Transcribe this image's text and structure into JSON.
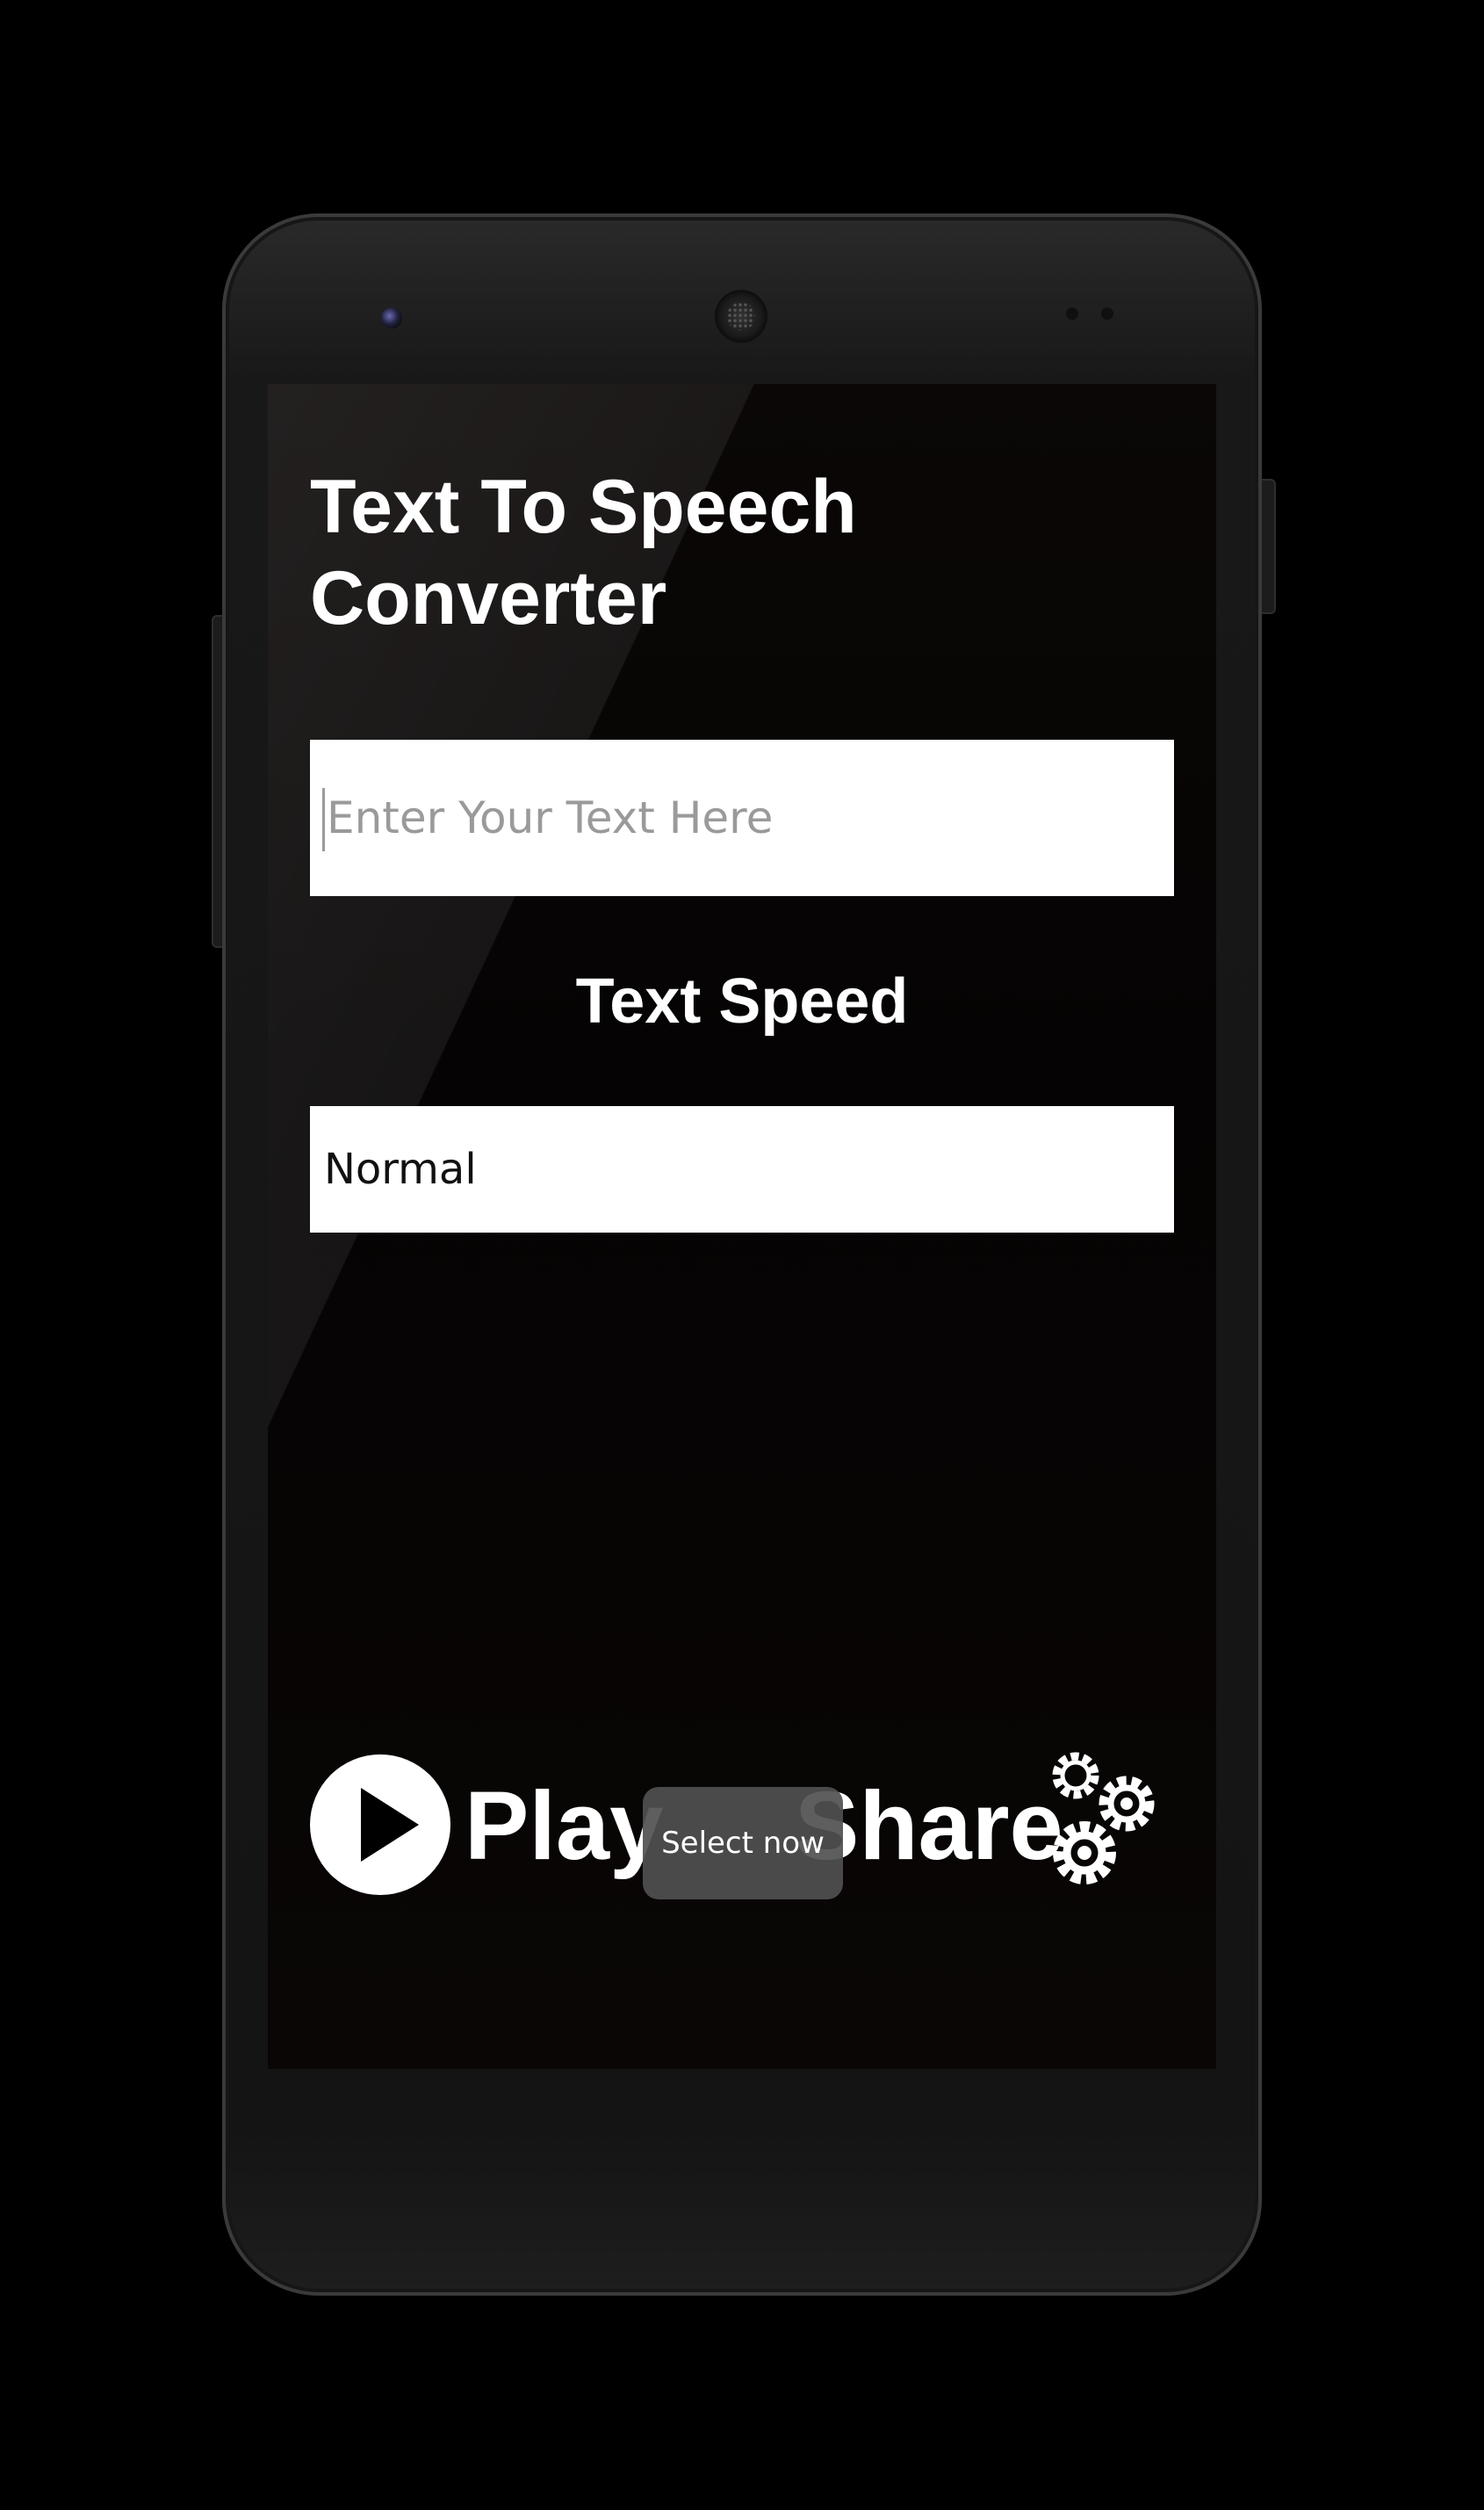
{
  "app": {
    "title": "Text To Speech Converter"
  },
  "text_input": {
    "value": "",
    "placeholder": "Enter Your Text Here"
  },
  "speed": {
    "label": "Text Speed",
    "selected": "Normal"
  },
  "controls": {
    "play_label": "Play",
    "share_label": "Share"
  },
  "toast": {
    "message": "Select now"
  },
  "icons": {
    "play": "play-icon",
    "settings": "gears-icon"
  },
  "colors": {
    "background": "#000000",
    "screen": "#050303",
    "text": "#ffffff",
    "field": "#ffffff",
    "placeholder": "#9a9a9a",
    "toast": "#505050"
  }
}
